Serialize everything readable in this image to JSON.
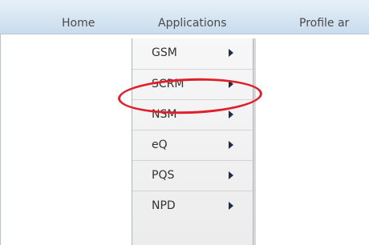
{
  "menubar": {
    "items": [
      {
        "label": "Home"
      },
      {
        "label": "Applications"
      },
      {
        "label": "Profile ar"
      }
    ]
  },
  "applications_menu": {
    "items": [
      {
        "label": "GSM",
        "icon": "chevron-right-icon"
      },
      {
        "label": "SCRM",
        "icon": "chevron-right-icon",
        "highlighted": true
      },
      {
        "label": "NSM",
        "icon": "chevron-right-icon"
      },
      {
        "label": "eQ",
        "icon": "chevron-right-icon"
      },
      {
        "label": "PQS",
        "icon": "chevron-right-icon"
      },
      {
        "label": "NPD",
        "icon": "chevron-right-icon"
      }
    ]
  },
  "colors": {
    "menubar_top": "#e7f0f8",
    "menubar_bottom": "#c9dced",
    "highlight": "#e01f2a",
    "arrow": "#1f2f48"
  }
}
